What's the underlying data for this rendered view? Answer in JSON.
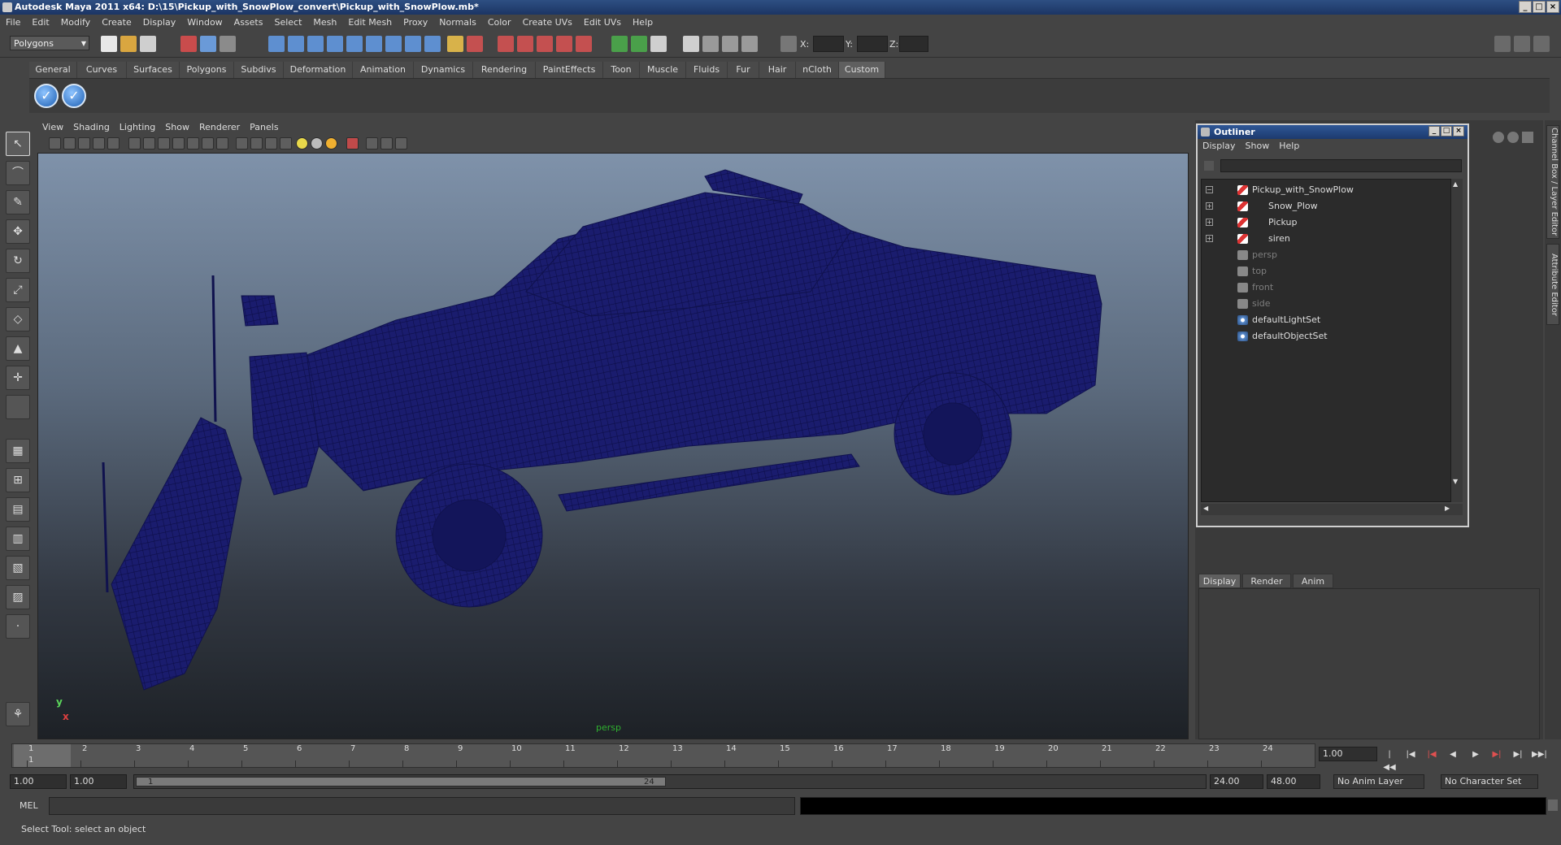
{
  "window": {
    "title": "Autodesk Maya 2011 x64: D:\\15\\Pickup_with_SnowPlow_convert\\Pickup_with_SnowPlow.mb*"
  },
  "menubar": [
    "File",
    "Edit",
    "Modify",
    "Create",
    "Display",
    "Window",
    "Assets",
    "Select",
    "Mesh",
    "Edit Mesh",
    "Proxy",
    "Normals",
    "Color",
    "Create UVs",
    "Edit UVs",
    "Help"
  ],
  "statusline": {
    "mode": "Polygons",
    "x_label": "X:",
    "y_label": "Y:",
    "z_label": "Z:"
  },
  "shelf": {
    "tabs": [
      "General",
      "Curves",
      "Surfaces",
      "Polygons",
      "Subdivs",
      "Deformation",
      "Animation",
      "Dynamics",
      "Rendering",
      "PaintEffects",
      "Toon",
      "Muscle",
      "Fluids",
      "Fur",
      "Hair",
      "nCloth",
      "Custom"
    ],
    "active_tab": "Custom",
    "buttons": [
      "check-button",
      "check-button"
    ]
  },
  "viewport": {
    "menus": [
      "View",
      "Shading",
      "Lighting",
      "Show",
      "Renderer",
      "Panels"
    ],
    "camera_label": "persp",
    "axis_y": "y",
    "axis_x": "x",
    "wire_color": "#17186b"
  },
  "outliner": {
    "title": "Outliner",
    "menus": [
      "Display",
      "Show",
      "Help"
    ],
    "items": [
      {
        "label": "Pickup_with_SnowPlow",
        "icon": "transform-icon",
        "expand": "minus",
        "indent": 0,
        "dim": false
      },
      {
        "label": "Snow_Plow",
        "icon": "transform-icon",
        "expand": "plus",
        "indent": 1,
        "dim": false
      },
      {
        "label": "Pickup",
        "icon": "transform-icon",
        "expand": "plus",
        "indent": 1,
        "dim": false
      },
      {
        "label": "siren",
        "icon": "transform-icon",
        "expand": "plus",
        "indent": 1,
        "dim": false
      },
      {
        "label": "persp",
        "icon": "camera-icon",
        "expand": "",
        "indent": 0,
        "dim": true
      },
      {
        "label": "top",
        "icon": "camera-icon",
        "expand": "",
        "indent": 0,
        "dim": true
      },
      {
        "label": "front",
        "icon": "camera-icon",
        "expand": "",
        "indent": 0,
        "dim": true
      },
      {
        "label": "side",
        "icon": "camera-icon",
        "expand": "",
        "indent": 0,
        "dim": true
      },
      {
        "label": "defaultLightSet",
        "icon": "set-icon",
        "expand": "",
        "indent": 0,
        "dim": false
      },
      {
        "label": "defaultObjectSet",
        "icon": "set-icon",
        "expand": "",
        "indent": 0,
        "dim": false
      }
    ]
  },
  "side_tabs": [
    "Channel Box / Layer Editor",
    "Attribute Editor"
  ],
  "layer_tabs": [
    "Display",
    "Render",
    "Anim"
  ],
  "timeline": {
    "ticks": [
      "1",
      "2",
      "3",
      "4",
      "5",
      "6",
      "7",
      "8",
      "9",
      "10",
      "11",
      "12",
      "13",
      "14",
      "15",
      "16",
      "17",
      "18",
      "19",
      "20",
      "21",
      "22",
      "23",
      "24"
    ],
    "current_frame_label": "1",
    "current_frame": "1.00"
  },
  "range": {
    "start": "1.00",
    "playback_start": "1.00",
    "slider_start": "1",
    "slider_end": "24",
    "playback_end": "24.00",
    "end": "48.00",
    "anim_layer": "No Anim Layer",
    "character_set": "No Character Set"
  },
  "command": {
    "label": "MEL"
  },
  "help": {
    "text": "Select Tool: select an object"
  }
}
